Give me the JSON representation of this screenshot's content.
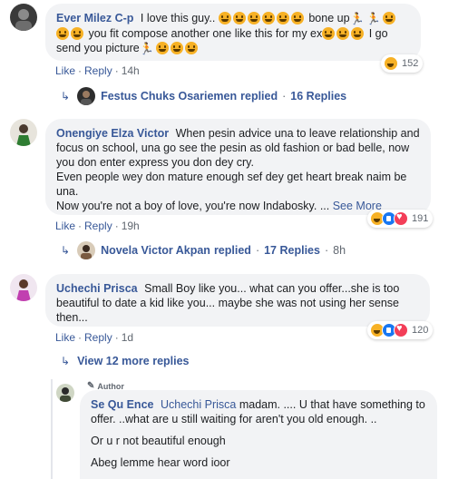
{
  "comments": [
    {
      "name": "Ever Milez C-p",
      "text_a": "I love this guy..",
      "text_b": "bone up",
      "text_c": "you fit compose another one like this for my ex",
      "text_d": "I go send you picture",
      "like": "Like",
      "reply": "Reply",
      "time": "14h",
      "reaction_count": "152",
      "replies_by": "Festus Chuks Osariemen",
      "replied_word": "replied",
      "replies_count": "16 Replies"
    },
    {
      "name": "Onengiye Elza Victor",
      "text_1": "When pesin advice una to leave relationship and focus on school, una go see the pesin as old fashion or bad belle, now you don enter express you don dey cry.",
      "text_2": "Even people wey don mature enough sef dey get heart break naim be una.",
      "text_3": "Now you're not a boy of love, you're now Indabosky. ...",
      "see_more": "See More",
      "like": "Like",
      "reply": "Reply",
      "time": "19h",
      "reaction_count": "191",
      "replies_by": "Novela Victor Akpan",
      "replied_word": "replied",
      "replies_count": "17 Replies",
      "replies_time": "8h"
    },
    {
      "name": "Uchechi Prisca",
      "text": "Small Boy like you... what can you offer...she is too beautiful to date a kid like you... maybe she was not using her sense then...",
      "like": "Like",
      "reply": "Reply",
      "time": "1d",
      "reaction_count": "120",
      "view_more": "View 12 more replies"
    }
  ],
  "reply": {
    "badge": "Author",
    "name": "Se Qu Ence",
    "mention": "Uchechi Prisca",
    "text_1": "madam. .... U that have something to offer. ..what are u still waiting for aren't you old enough. ..",
    "text_2": "Or u r not beautiful enough",
    "text_3": "Abeg lemme hear word ioor"
  },
  "colors": {
    "link": "#385898",
    "bubble": "#f2f3f5",
    "meta": "#606770",
    "like_blue": "#1877f2",
    "love_red": "#f33e58",
    "haha_yellow": "#f7b125"
  }
}
